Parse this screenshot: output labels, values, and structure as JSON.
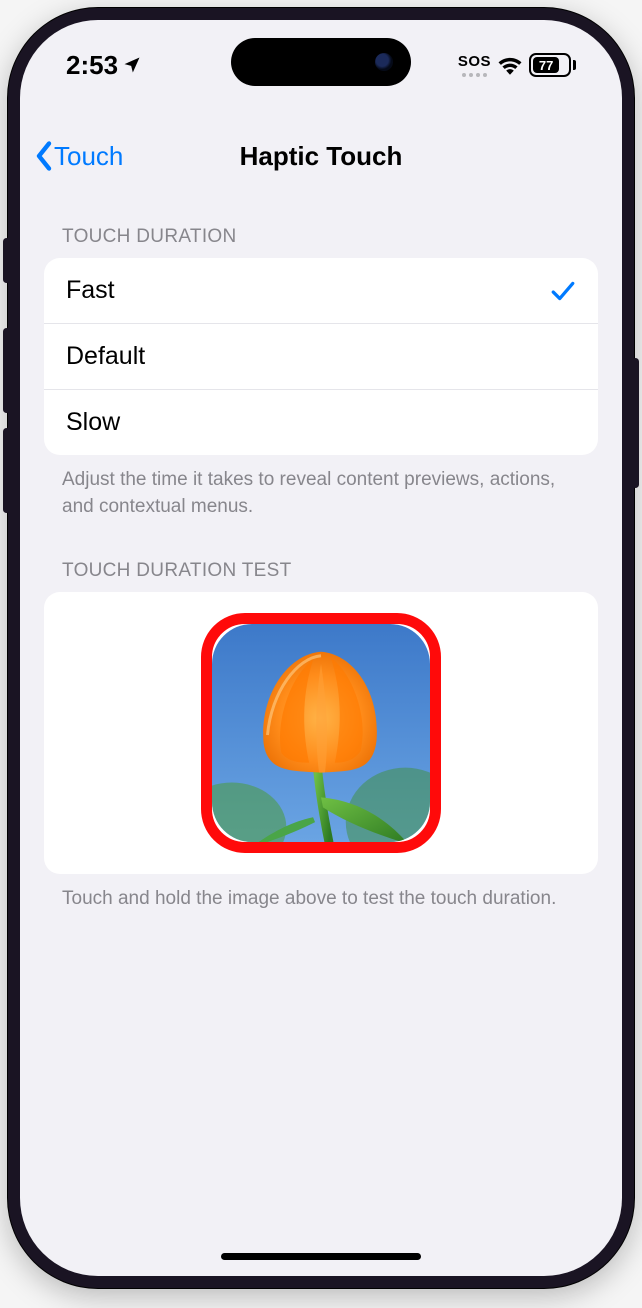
{
  "status": {
    "time": "2:53",
    "sos": "SOS",
    "battery_pct": "77"
  },
  "nav": {
    "back_label": "Touch",
    "title": "Haptic Touch"
  },
  "duration_section": {
    "header": "TOUCH DURATION",
    "options": {
      "fast": "Fast",
      "default": "Default",
      "slow": "Slow"
    },
    "selected": "fast",
    "footer": "Adjust the time it takes to reveal content previews, actions, and contextual menus."
  },
  "test_section": {
    "header": "TOUCH DURATION TEST",
    "footer": "Touch and hold the image above to test the touch duration."
  }
}
